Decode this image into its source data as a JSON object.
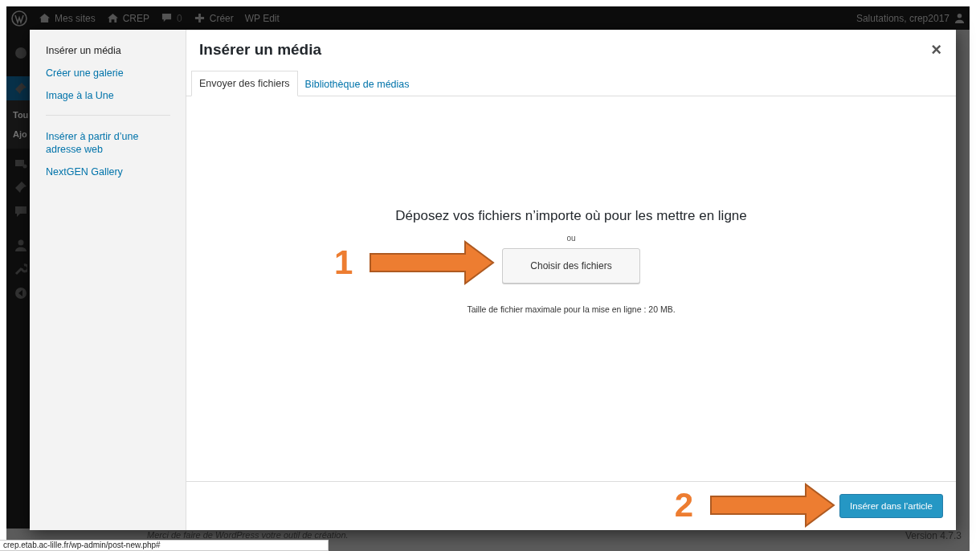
{
  "admin_bar": {
    "items": [
      {
        "kind": "sites",
        "label": "Mes sites"
      },
      {
        "kind": "home",
        "label": "CREP"
      },
      {
        "kind": "comments",
        "label": "0"
      },
      {
        "kind": "new",
        "label": "Créer"
      },
      {
        "kind": "plain",
        "label": "WP Edit"
      }
    ],
    "greeting": "Salutations, crep2017"
  },
  "admin_menu": {
    "partial_labels": [
      "Tou",
      "Ajo"
    ]
  },
  "modal": {
    "menu_groups": [
      [
        {
          "label": "Insérer un média",
          "selected": true
        },
        {
          "label": "Créer une galerie",
          "selected": false
        },
        {
          "label": "Image à la Une",
          "selected": false
        }
      ],
      [
        {
          "label": "Insérer à partir d’une adresse web",
          "selected": false
        },
        {
          "label": "NextGEN Gallery",
          "selected": false
        }
      ]
    ],
    "title": "Insérer un média",
    "close": "×",
    "tabs": [
      {
        "label": "Envoyer des fichiers",
        "selected": true
      },
      {
        "label": "Bibliothèque de médias",
        "selected": false
      }
    ],
    "upload": {
      "instructions": "Déposez vos fichiers n’importe où pour les mettre en ligne",
      "or": "ou",
      "button": "Choisir des fichiers",
      "max_size": "Taille de fichier maximale pour la mise en ligne : 20 MB."
    },
    "footer_button": "Insérer dans l’article"
  },
  "annotations": [
    {
      "number": "1"
    },
    {
      "number": "2"
    }
  ],
  "footer": {
    "thanks": "Merci de faire de WordPress votre outil de création.",
    "version": "Version 4.7.3"
  },
  "status_url": "crep.etab.ac-lille.fr/wp-admin/post-new.php#"
}
